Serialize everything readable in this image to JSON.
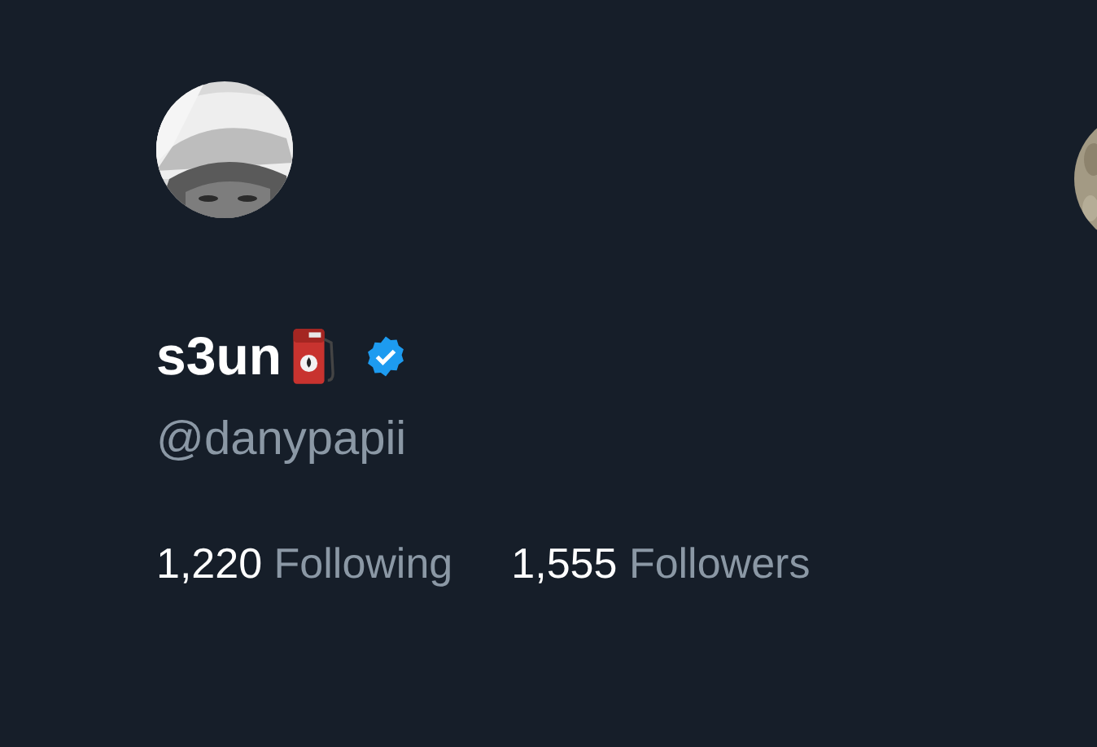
{
  "profile": {
    "name": "s3un",
    "verified": true,
    "handle": "@danypapii",
    "stats": [
      {
        "count": "1,220",
        "label": "Following"
      },
      {
        "count": "1,555",
        "label": "Followers"
      }
    ]
  }
}
